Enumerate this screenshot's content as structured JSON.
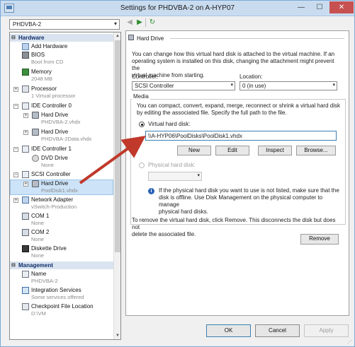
{
  "window": {
    "title": "Settings for PHDVBA-2 on A-HYP07",
    "minimize": "—",
    "maximize": "☐",
    "close": "✕"
  },
  "vm_selector": {
    "value": "PHDVBA-2"
  },
  "tree": {
    "hardware_header": "Hardware",
    "management_header": "Management",
    "items": {
      "add_hardware": {
        "name": "Add Hardware"
      },
      "bios": {
        "name": "BIOS",
        "sub": "Boot from CD"
      },
      "memory": {
        "name": "Memory",
        "sub": "2048 MB"
      },
      "processor": {
        "name": "Processor",
        "sub": "1 Virtual processor"
      },
      "ide0": {
        "name": "IDE Controller 0"
      },
      "ide0_hd1": {
        "name": "Hard Drive",
        "sub": "PHDVBA-2.vhdx"
      },
      "ide0_hd2": {
        "name": "Hard Drive",
        "sub": "PHDVBA-2Data.vhdx"
      },
      "ide1": {
        "name": "IDE Controller 1"
      },
      "dvd": {
        "name": "DVD Drive",
        "sub": "None"
      },
      "scsi": {
        "name": "SCSI Controller"
      },
      "scsi_hd": {
        "name": "Hard Drive",
        "sub": "PoolDisk1.vhdx"
      },
      "network": {
        "name": "Network Adapter",
        "sub": "vSwitch-Production"
      },
      "com1": {
        "name": "COM 1",
        "sub": "None"
      },
      "com2": {
        "name": "COM 2",
        "sub": "None"
      },
      "diskette": {
        "name": "Diskette Drive",
        "sub": "None"
      },
      "name": {
        "name": "Name",
        "sub": "PHDVBA-2"
      },
      "integration": {
        "name": "Integration Services",
        "sub": "Some services offered"
      },
      "checkpoint": {
        "name": "Checkpoint File Location",
        "sub": "D:\\VM"
      }
    }
  },
  "toolbar": {
    "back": "◀",
    "forward": "▶",
    "refresh": "↻"
  },
  "panel": {
    "section_title": "Hard Drive",
    "intro": [
      "You can change how this virtual hard disk is attached to the virtual machine. If an",
      "operating system is installed on this disk, changing the attachment might prevent the",
      "virtual machine from starting."
    ],
    "controller_label": "Controller:",
    "controller_value": "SCSI Controller",
    "location_label": "Location:",
    "location_value": "0 (in use)",
    "media_label": "Media",
    "media_text": [
      "You can compact, convert, expand, merge, reconnect or shrink a virtual hard disk",
      "by editing the associated file. Specify the full path to the file."
    ],
    "virtual_disk_label": "Virtual hard disk:",
    "virtual_disk_path": "\\\\A-HYP06\\PoolDisks\\PoolDisk1.vhdx",
    "btn_new": "New",
    "btn_edit": "Edit",
    "btn_inspect": "Inspect",
    "btn_browse": "Browse...",
    "physical_disk_label": "Physical hard disk:",
    "physical_info": [
      "If the physical hard disk you want to use is not listed, make sure that the",
      "disk is offline. Use Disk Management on the physical computer to manage",
      "physical hard disks."
    ],
    "remove_text": [
      "To remove the virtual hard disk, click Remove. This disconnects the disk but does not",
      "delete the associated file."
    ],
    "btn_remove": "Remove"
  },
  "footer": {
    "ok": "OK",
    "cancel": "Cancel",
    "apply": "Apply"
  },
  "annotation": {
    "arrow_color": "#c0392b"
  }
}
